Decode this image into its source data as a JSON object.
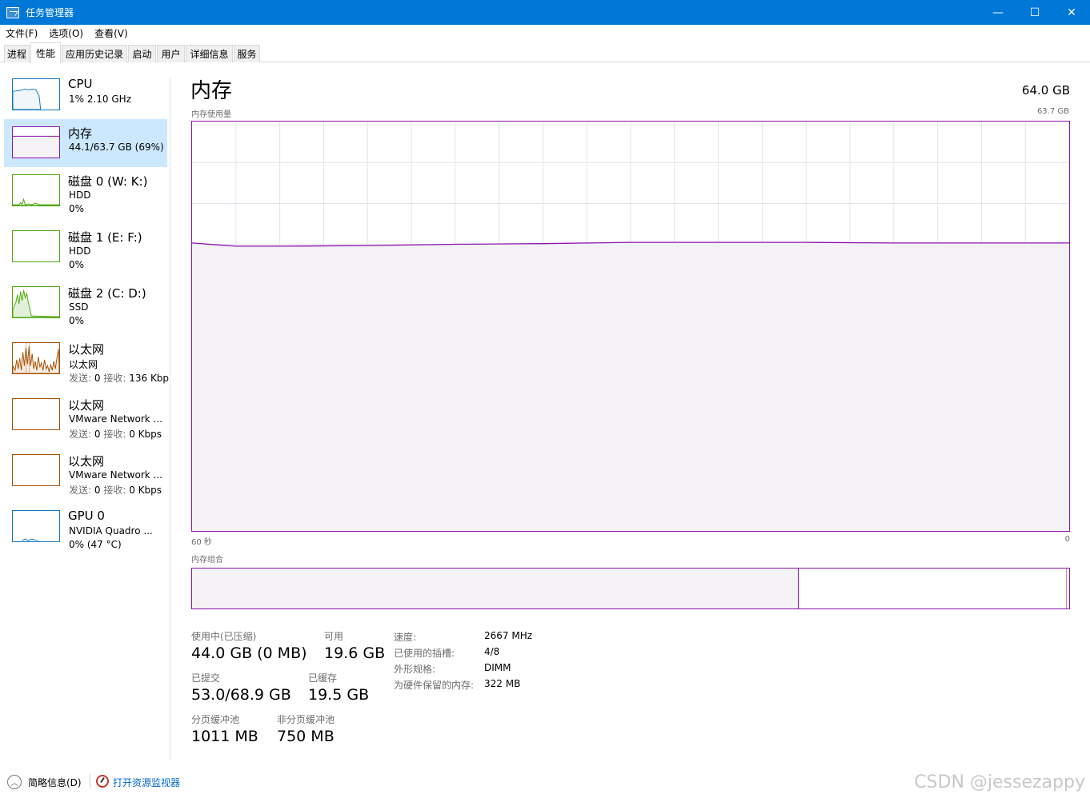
{
  "window": {
    "title": "任务管理器",
    "minimize_glyph": "—",
    "maximize_glyph": "☐",
    "close_glyph": "✕"
  },
  "menu": [
    "文件(F)",
    "选项(O)",
    "查看(V)"
  ],
  "tabs": [
    {
      "label": "进程"
    },
    {
      "label": "性能"
    },
    {
      "label": "应用历史记录"
    },
    {
      "label": "启动"
    },
    {
      "label": "用户"
    },
    {
      "label": "详细信息"
    },
    {
      "label": "服务"
    }
  ],
  "sidebar": {
    "items": [
      {
        "title": "CPU",
        "sub1": "1% 2.10 GHz",
        "sub2": "",
        "color": "#1177bb"
      },
      {
        "title": "内存",
        "sub1": "44.1/63.7 GB (69%)",
        "sub2": "",
        "color": "#8b12ae"
      },
      {
        "title": "磁盘 0 (W: K:)",
        "sub1": "HDD",
        "sub2": "0%",
        "color": "#4da60c"
      },
      {
        "title": "磁盘 1 (E: F:)",
        "sub1": "HDD",
        "sub2": "0%",
        "color": "#4da60c"
      },
      {
        "title": "磁盘 2 (C: D:)",
        "sub1": "SSD",
        "sub2": "0%",
        "color": "#4da60c"
      },
      {
        "title": "以太网",
        "sub1": "以太网",
        "sub2_send_label": "发送:",
        "sub2_send": "0",
        "sub2_recv_label": "接收:",
        "sub2_recv": "136 Kbp",
        "color": "#a74f01"
      },
      {
        "title": "以太网",
        "sub1": "VMware Network ...",
        "sub2_send_label": "发送:",
        "sub2_send": "0",
        "sub2_recv_label": "接收:",
        "sub2_recv": "0 Kbps",
        "color": "#a74f01"
      },
      {
        "title": "以太网",
        "sub1": "VMware Network ...",
        "sub2_send_label": "发送:",
        "sub2_send": "0",
        "sub2_recv_label": "接收:",
        "sub2_recv": "0 Kbps",
        "color": "#a74f01"
      },
      {
        "title": "GPU 0",
        "sub1": "NVIDIA Quadro ...",
        "sub2": "0% (47 °C)",
        "color": "#1177bb"
      }
    ]
  },
  "main": {
    "title": "内存",
    "total": "64.0 GB",
    "chart_label": "内存使用量",
    "chart_max_label": "63.7 GB",
    "axis_left": "60 秒",
    "axis_right": "0",
    "composition_label": "内存组合",
    "composition": {
      "in_use_fraction": 0.692,
      "modified_fraction": 0.305
    }
  },
  "stats": {
    "in_use_label": "使用中(已压缩)",
    "in_use": "44.0 GB (0 MB)",
    "available_label": "可用",
    "available": "19.6 GB",
    "committed_label": "已提交",
    "committed": "53.0/68.9 GB",
    "cached_label": "已缓存",
    "cached": "19.5 GB",
    "paged_label": "分页缓冲池",
    "paged": "1011 MB",
    "nonpaged_label": "非分页缓冲池",
    "nonpaged": "750 MB",
    "speed_label": "速度:",
    "speed": "2667 MHz",
    "slots_label": "已使用的插槽:",
    "slots": "4/8",
    "form_label": "外形规格:",
    "form": "DIMM",
    "reserved_label": "为硬件保留的内存:",
    "reserved": "322 MB"
  },
  "footer": {
    "brief": "简略信息(D)",
    "monitor_link": "打开资源监视器",
    "watermark": "CSDN @jessezappy"
  },
  "chart_data": {
    "type": "area",
    "x_label": "60 秒",
    "y_max_label": "63.7 GB",
    "ylim": [
      0,
      63.7
    ],
    "x": [
      60,
      57,
      54,
      48,
      42,
      36,
      30,
      27,
      24,
      18,
      12,
      6,
      0
    ],
    "values": [
      44.8,
      44.3,
      44.3,
      44.4,
      44.6,
      44.7,
      44.9,
      44.9,
      44.9,
      44.9,
      44.8,
      44.8,
      44.8
    ]
  }
}
